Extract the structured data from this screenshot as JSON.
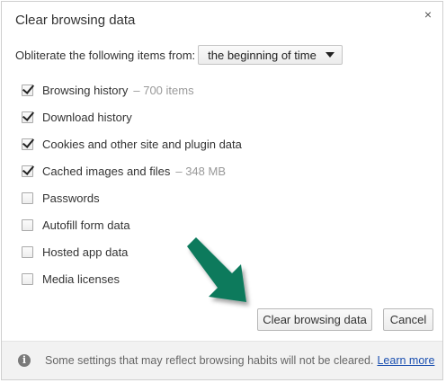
{
  "dialog": {
    "title": "Clear browsing data",
    "close_glyph": "×"
  },
  "obliterate": {
    "label": "Obliterate the following items from:",
    "selected": "the beginning of time"
  },
  "items": [
    {
      "label": "Browsing history",
      "count": "– 700 items",
      "checked": true
    },
    {
      "label": "Download history",
      "count": "",
      "checked": true
    },
    {
      "label": "Cookies and other site and plugin data",
      "count": "",
      "checked": true
    },
    {
      "label": "Cached images and files",
      "count": "– 348 MB",
      "checked": true
    },
    {
      "label": "Passwords",
      "count": "",
      "checked": false
    },
    {
      "label": "Autofill form data",
      "count": "",
      "checked": false
    },
    {
      "label": "Hosted app data",
      "count": "",
      "checked": false
    },
    {
      "label": "Media licenses",
      "count": "",
      "checked": false
    }
  ],
  "buttons": {
    "clear": "Clear browsing data",
    "cancel": "Cancel"
  },
  "footer": {
    "info_glyph": "i",
    "text": "Some settings that may reflect browsing habits will not be cleared.",
    "link": "Learn more"
  },
  "colors": {
    "arrow": "#0b7a5c",
    "link": "#1a4fb0"
  },
  "icons": [
    "close-icon",
    "dropdown-caret-icon",
    "checkmark-icon",
    "info-icon",
    "arrow-annotation-icon"
  ]
}
